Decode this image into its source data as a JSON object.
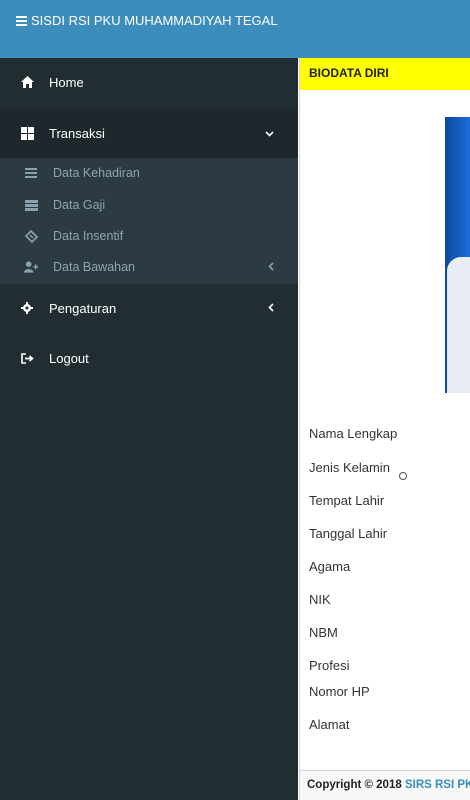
{
  "header": {
    "title": "SISDI RSI PKU MUHAMMADIYAH TEGAL"
  },
  "sidebar": {
    "home": "Home",
    "transaksi": "Transaksi",
    "submenu": [
      "Data Kehadiran",
      "Data Gaji",
      "Data Insentif",
      "Data Bawahan"
    ],
    "pengaturan": "Pengaturan",
    "logout": "Logout"
  },
  "content": {
    "section_title": "BIODATA DIRI",
    "fields": [
      "Nama Lengkap",
      "Jenis Kelamin",
      "Tempat Lahir",
      "Tanggal Lahir",
      "Agama",
      "NIK",
      "NBM",
      "Profesi",
      "Nomor HP",
      "Alamat"
    ]
  },
  "footer": {
    "prefix": "Copyright © 2018 ",
    "link": "SIRS RSI PKU"
  },
  "colors": {
    "header": "#3c8dbc",
    "sidebar": "#222d32",
    "submenu": "#2c3b41",
    "highlight": "#ffff00"
  }
}
